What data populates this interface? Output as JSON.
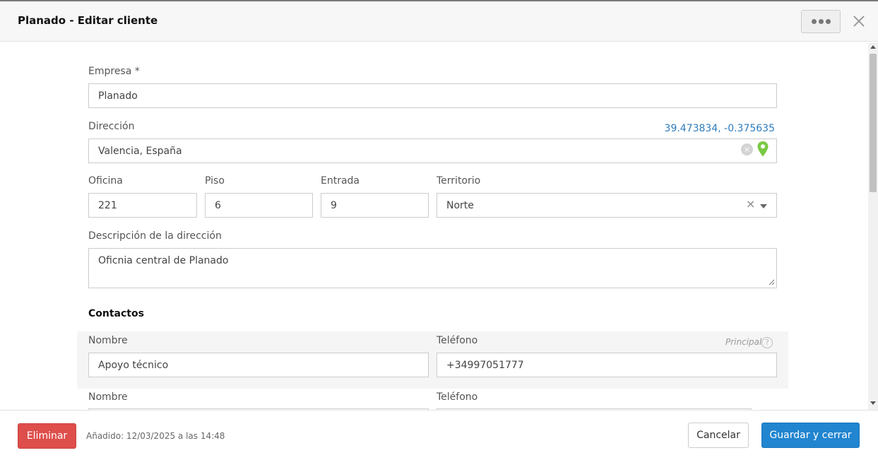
{
  "window": {
    "title": "Planado - Editar cliente"
  },
  "form": {
    "company": {
      "label": "Empresa *",
      "value": "Planado"
    },
    "address": {
      "label": "Dirección",
      "value": "Valencia, España",
      "coords": "39.473834, -0.375635"
    },
    "office": {
      "label": "Oficina",
      "value": "221"
    },
    "floor": {
      "label": "Piso",
      "value": "6"
    },
    "entrance": {
      "label": "Entrada",
      "value": "9"
    },
    "territory": {
      "label": "Territorio",
      "value": "Norte"
    },
    "address_desc": {
      "label": "Descripción de la dirección",
      "value": "Oficnia central de Planado"
    }
  },
  "contacts": {
    "title": "Contactos",
    "principal_label": "Principal",
    "items": [
      {
        "name_label": "Nombre",
        "name": "Apoyo técnico",
        "phone_label": "Teléfono",
        "phone": "+34997051777"
      },
      {
        "name_label": "Nombre",
        "phone_label": "Teléfono"
      }
    ]
  },
  "footer": {
    "delete_label": "Eliminar",
    "added_text": "Añadido: 12/03/2025 a las 14:48",
    "cancel_label": "Cancelar",
    "save_label": "Guardar y cerrar"
  },
  "colors": {
    "primary": "#2185d0",
    "danger": "#de4e4b",
    "link": "#2e7dbf",
    "pin": "#7ac943"
  }
}
